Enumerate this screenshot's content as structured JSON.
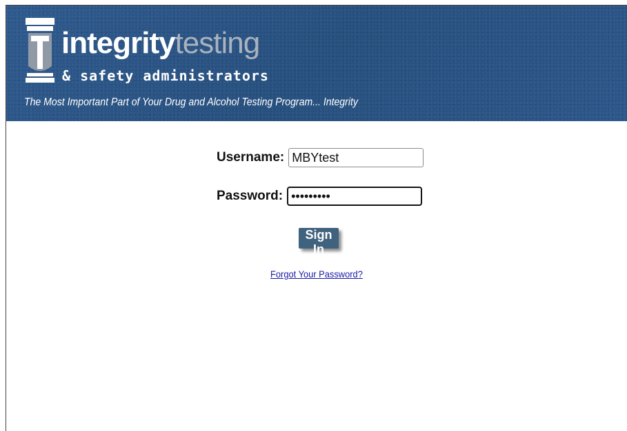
{
  "header": {
    "brand_strong": "integrity",
    "brand_light": "testing",
    "subtitle": "& safety administrators",
    "tagline": "The Most Important Part of Your Drug and Alcohol Testing Program... Integrity",
    "logo_icon": "it-monogram-logo",
    "colors": {
      "banner_bg": "#2b5486",
      "brand_strong": "#ffffff",
      "brand_light": "#a9b2bd"
    }
  },
  "login": {
    "username_label": "Username:",
    "username_value": "MBYtest",
    "password_label": "Password:",
    "password_value": "•••••••••",
    "signin_label": "Sign In",
    "forgot_link": "Forgot Your Password?",
    "colors": {
      "button_bg": "#3f627e",
      "link": "#1a1aa8"
    }
  }
}
